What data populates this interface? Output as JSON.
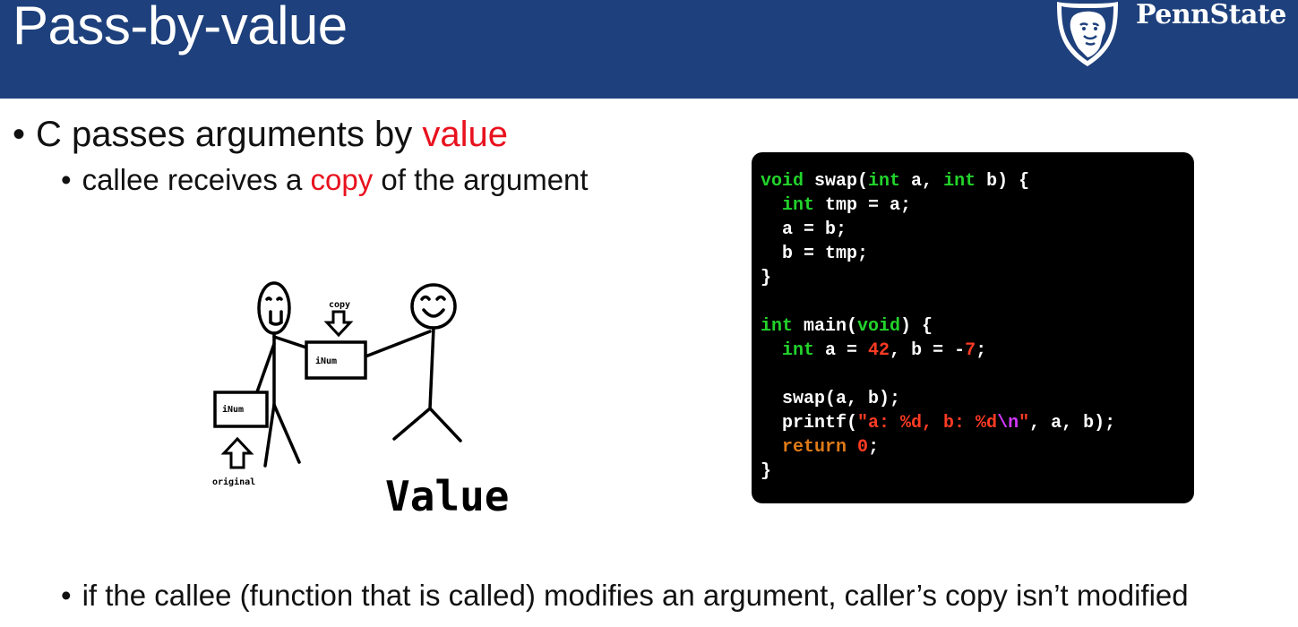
{
  "header": {
    "title": "Pass-by-value",
    "brand": "PennState",
    "logo_icon": "nittany-lion-shield-icon"
  },
  "bullets": [
    {
      "level": 1,
      "parts": [
        {
          "text": "C passes arguments by ",
          "color": "#111111"
        },
        {
          "text": "value",
          "color": "#e8121e"
        }
      ]
    },
    {
      "level": 2,
      "parts": [
        {
          "text": "callee receives a ",
          "color": "#111111"
        },
        {
          "text": "copy",
          "color": "#e8121e"
        },
        {
          "text": " of the argument",
          "color": "#111111"
        }
      ]
    },
    {
      "level": 2,
      "parts": [
        {
          "text": "if the callee (function that is called) modifies an argument, caller’s copy isn’t modified",
          "color": "#111111"
        }
      ]
    }
  ],
  "illustration": {
    "caller_box_label": "iNum",
    "callee_box_label": "iNum",
    "copy_label": "copy",
    "original_label": "original",
    "caption": "Value"
  },
  "code": {
    "lines": [
      [
        {
          "t": "void",
          "k": "kw"
        },
        {
          "t": " swap(",
          "k": "plain"
        },
        {
          "t": "int",
          "k": "kw"
        },
        {
          "t": " a, ",
          "k": "plain"
        },
        {
          "t": "int",
          "k": "kw"
        },
        {
          "t": " b) {",
          "k": "plain"
        }
      ],
      [
        {
          "t": "  ",
          "k": "plain"
        },
        {
          "t": "int",
          "k": "kw"
        },
        {
          "t": " tmp = a;",
          "k": "plain"
        }
      ],
      [
        {
          "t": "  a = b;",
          "k": "plain"
        }
      ],
      [
        {
          "t": "  b = tmp;",
          "k": "plain"
        }
      ],
      [
        {
          "t": "}",
          "k": "plain"
        }
      ],
      [],
      [
        {
          "t": "int",
          "k": "kw"
        },
        {
          "t": " main(",
          "k": "plain"
        },
        {
          "t": "void",
          "k": "kw"
        },
        {
          "t": ") {",
          "k": "plain"
        }
      ],
      [
        {
          "t": "  ",
          "k": "plain"
        },
        {
          "t": "int",
          "k": "kw"
        },
        {
          "t": " a = ",
          "k": "plain"
        },
        {
          "t": "42",
          "k": "num"
        },
        {
          "t": ", b = -",
          "k": "plain"
        },
        {
          "t": "7",
          "k": "num"
        },
        {
          "t": ";",
          "k": "plain"
        }
      ],
      [],
      [
        {
          "t": "  swap(a, b);",
          "k": "plain"
        }
      ],
      [
        {
          "t": "  printf(",
          "k": "plain"
        },
        {
          "t": "\"a: %d, b: %d",
          "k": "str"
        },
        {
          "t": "\\n",
          "k": "esc"
        },
        {
          "t": "\"",
          "k": "str"
        },
        {
          "t": ", a, b);",
          "k": "plain"
        }
      ],
      [
        {
          "t": "  ",
          "k": "plain"
        },
        {
          "t": "return",
          "k": "ret"
        },
        {
          "t": " ",
          "k": "plain"
        },
        {
          "t": "0",
          "k": "num"
        },
        {
          "t": ";",
          "k": "plain"
        }
      ],
      [
        {
          "t": "}",
          "k": "plain"
        }
      ]
    ]
  }
}
